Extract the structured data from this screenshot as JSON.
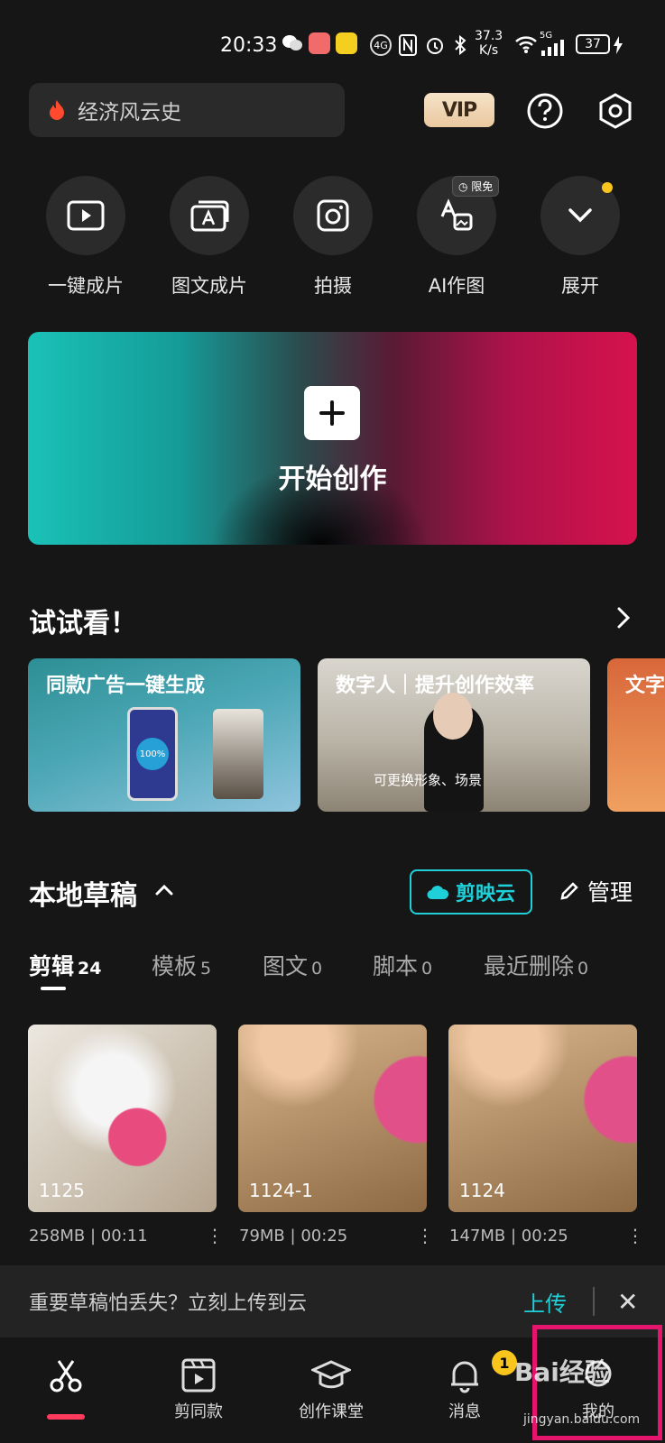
{
  "status_bar": {
    "time": "20:33",
    "speed_value": "37.3",
    "speed_unit": "K/s",
    "network": "5G",
    "battery": "37"
  },
  "header": {
    "search_text": "经济风云史",
    "vip_label": "VIP"
  },
  "quick_actions": [
    {
      "label": "一键成片",
      "icon": "play-icon"
    },
    {
      "label": "图文成片",
      "icon": "text-card-icon"
    },
    {
      "label": "拍摄",
      "icon": "camera-icon"
    },
    {
      "label": "AI作图",
      "icon": "ai-image-icon"
    },
    {
      "label": "展开",
      "icon": "chevron-down-icon"
    }
  ],
  "limit_badge": "限免",
  "hero": {
    "label": "开始创作"
  },
  "try_section": {
    "title": "试试看！",
    "cards": [
      {
        "title": "同款广告一键生成",
        "phone_text": "100%"
      },
      {
        "title": "数字人｜提升创作效率",
        "sub": "可更换形象、场景"
      },
      {
        "title": "文字"
      }
    ]
  },
  "drafts": {
    "title": "本地草稿",
    "cloud_label": "剪映云",
    "manage_label": "管理",
    "tabs": [
      {
        "label": "剪辑",
        "count": "24"
      },
      {
        "label": "模板",
        "count": "5"
      },
      {
        "label": "图文",
        "count": "0"
      },
      {
        "label": "脚本",
        "count": "0"
      },
      {
        "label": "最近删除",
        "count": "0"
      }
    ],
    "items": [
      {
        "name": "1125",
        "size": "258MB",
        "duration": "00:11"
      },
      {
        "name": "1124-1",
        "size": "79MB",
        "duration": "00:25"
      },
      {
        "name": "1124",
        "size": "147MB",
        "duration": "00:25"
      }
    ],
    "sep": "|"
  },
  "upload_banner": {
    "text": "重要草稿怕丢失？立刻上传到云",
    "upload_label": "上传",
    "close": "✕"
  },
  "bottom_nav": [
    {
      "label": "",
      "icon": "scissors-icon"
    },
    {
      "label": "剪同款",
      "icon": "template-icon"
    },
    {
      "label": "创作课堂",
      "icon": "graduation-cap-icon"
    },
    {
      "label": "消息",
      "icon": "bell-icon"
    },
    {
      "label": "我的",
      "icon": "profile-icon"
    }
  ],
  "message_badge": "1",
  "watermark": {
    "brand": "Bai经验",
    "url": "jingyan.baidu.com"
  },
  "colors": {
    "accent_cyan": "#1fd0d9",
    "active_red": "#ff3a5c",
    "badge_yellow": "#f7c51c",
    "highlight_pink": "#e5156e"
  }
}
